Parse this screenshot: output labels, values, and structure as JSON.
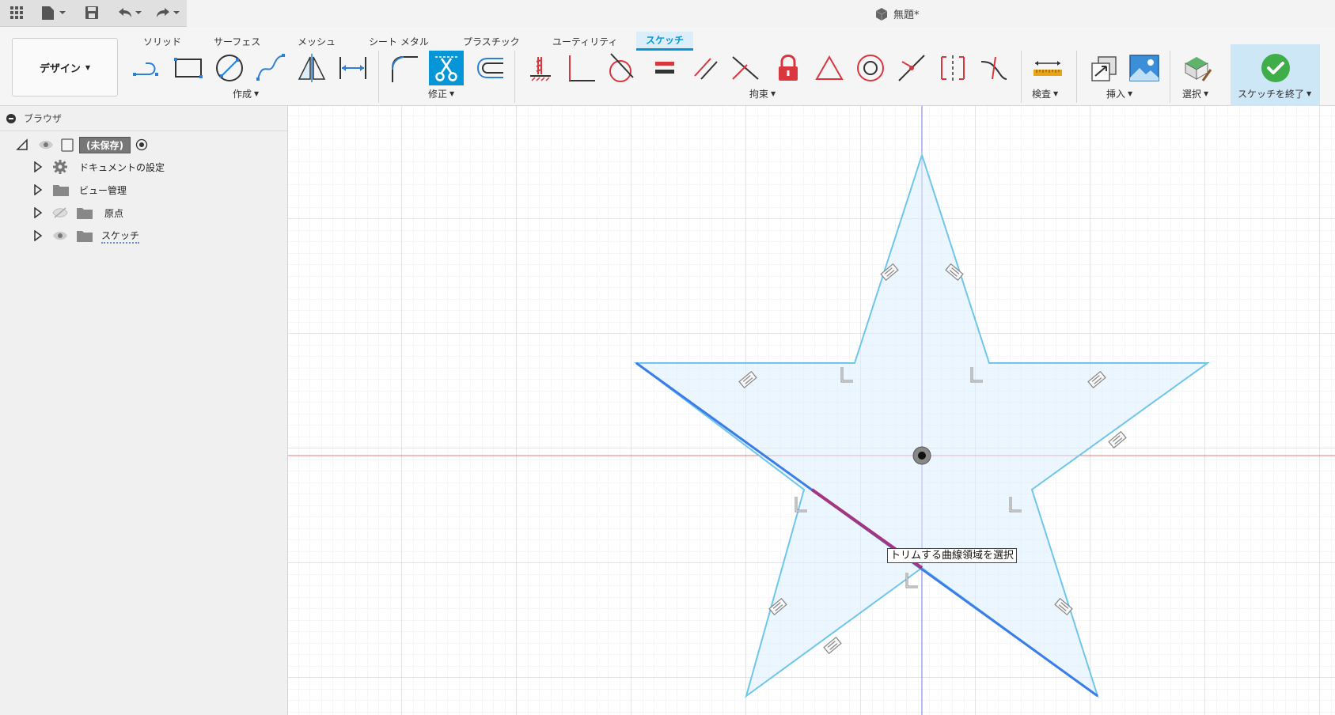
{
  "window": {
    "title": "無題*"
  },
  "workspace": {
    "label": "デザイン"
  },
  "tabs": [
    {
      "label": "ソリッド"
    },
    {
      "label": "サーフェス"
    },
    {
      "label": "メッシュ"
    },
    {
      "label": "シート メタル"
    },
    {
      "label": "プラスチック"
    },
    {
      "label": "ユーティリティ"
    },
    {
      "label": "スケッチ"
    }
  ],
  "groups": {
    "create": "作成",
    "modify": "修正",
    "constraints": "拘束",
    "inspect": "検査",
    "insert": "挿入",
    "select": "選択",
    "finish": "スケッチを終了"
  },
  "browser": {
    "title": "ブラウザ",
    "root": "(未保存)",
    "items": [
      {
        "label": "ドキュメントの設定"
      },
      {
        "label": "ビュー管理"
      },
      {
        "label": "原点"
      },
      {
        "label": "スケッチ"
      }
    ]
  },
  "tooltip": {
    "text": "トリムする曲線領域を選択"
  },
  "colors": {
    "accent": "#0696d7",
    "sketch_line": "#6ec6ea",
    "selected_line": "#3b7de8",
    "trim_highlight": "#a4357f",
    "constraint_red": "#d9363e",
    "axis_red": "#ee7777",
    "axis_blue": "#7a7ae8"
  }
}
